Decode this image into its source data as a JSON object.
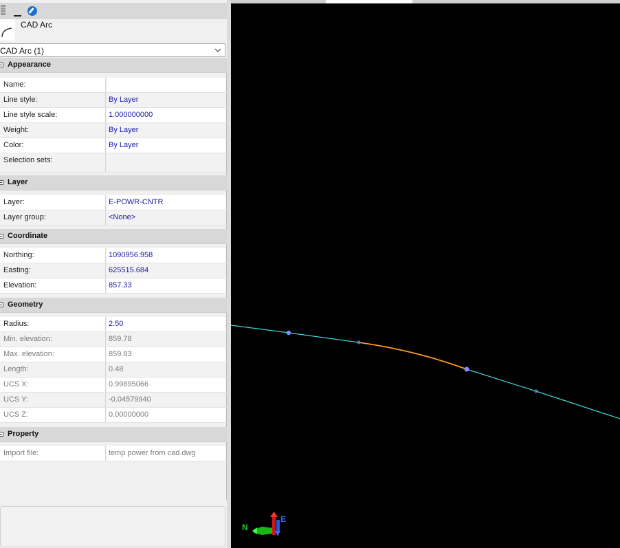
{
  "object": {
    "icon": "cad-arc-icon",
    "title": "CAD Arc",
    "selector_value": "CAD Arc (1)"
  },
  "sections": {
    "appearance": {
      "title": "Appearance",
      "rows": [
        {
          "label": "Name:",
          "value": ""
        },
        {
          "label": "Line style:",
          "value": "By Layer"
        },
        {
          "label": "Line style scale:",
          "value": "1.000000000"
        },
        {
          "label": "Weight:",
          "value": "By Layer"
        },
        {
          "label": "Color:",
          "value": "By Layer"
        },
        {
          "label": "Selection sets:",
          "value": ""
        }
      ]
    },
    "layer": {
      "title": "Layer",
      "rows": [
        {
          "label": "Layer:",
          "value": "E-POWR-CNTR"
        },
        {
          "label": "Layer group:",
          "value": "<None>"
        }
      ]
    },
    "coordinate": {
      "title": "Coordinate",
      "rows": [
        {
          "label": "Northing:",
          "value": "1090956.958"
        },
        {
          "label": "Easting:",
          "value": "625515.684"
        },
        {
          "label": "Elevation:",
          "value": "857.33"
        }
      ]
    },
    "geometry": {
      "title": "Geometry",
      "rows": [
        {
          "label": "Radius:",
          "value": "2.50"
        },
        {
          "label": "Min. elevation:",
          "value": "859.78"
        },
        {
          "label": "Max. elevation:",
          "value": "859.83"
        },
        {
          "label": "Length:",
          "value": "0.48"
        },
        {
          "label": "UCS X:",
          "value": "0.99895066"
        },
        {
          "label": "UCS Y:",
          "value": "-0.04579940"
        },
        {
          "label": "UCS Z:",
          "value": "0.00000000"
        }
      ]
    },
    "property": {
      "title": "Property",
      "rows": [
        {
          "label": "Import file:",
          "value": "temp power from cad.dwg"
        }
      ]
    }
  },
  "viewport": {
    "triad": {
      "north_label": "N",
      "east_label": "E"
    },
    "colors": {
      "background": "#000000",
      "linework": "#3fd6d6",
      "selected_arc": "#ff9a1f",
      "grip_point": "#8888ff"
    }
  }
}
